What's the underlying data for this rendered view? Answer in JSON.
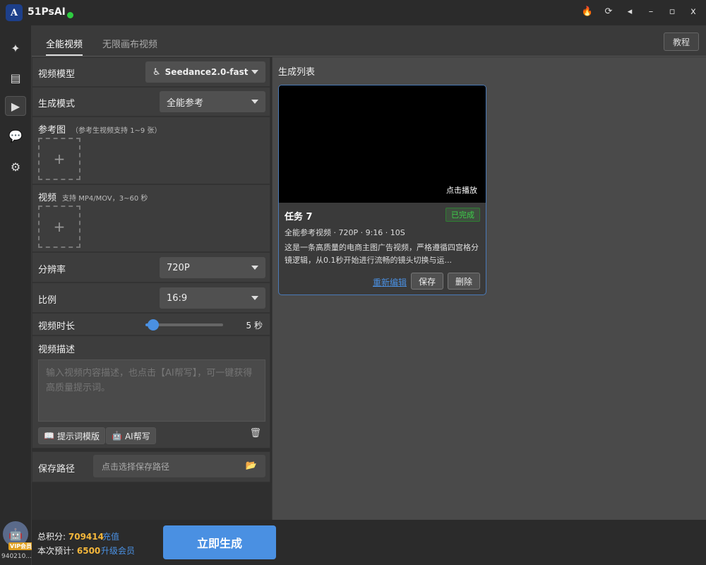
{
  "app": {
    "name": "51PsAI",
    "logo": "A"
  },
  "titlebar_icons": [
    "fire-icon",
    "refresh-icon",
    "pin-icon",
    "minimize-icon",
    "maximize-icon",
    "close-icon"
  ],
  "titlebar": {
    "minimize": "–",
    "maximize": "▫",
    "close": "x"
  },
  "tabs": [
    {
      "label": "全能视频"
    },
    {
      "label": "无限画布视频"
    }
  ],
  "help_label": "教程",
  "form": {
    "model_label": "视频模型",
    "model_value": "Seedance2.0-fast",
    "mode_label": "生成模式",
    "mode_value": "全能参考",
    "ref_label": "参考图",
    "ref_hint": "（参考生视频支持 1~9 张）",
    "video_label": "视频",
    "video_hint": "支持 MP4/MOV，3~60 秒",
    "plus": "+",
    "resolution_label": "分辨率",
    "resolution_value": "720P",
    "ratio_label": "比例",
    "ratio_value": "16:9",
    "duration_label": "视频时长",
    "duration_value": "5 秒",
    "duration_fraction": 0.1,
    "desc_label": "视频描述",
    "desc_placeholder": "输入视频内容描述，也点击【AI帮写】，可一键获得高质量提示词。",
    "template_btn": "提示词模版",
    "ai_btn": "AI帮写",
    "path_label": "保存路径",
    "path_placeholder": "点击选择保存路径"
  },
  "list": {
    "title": "生成列表",
    "card": {
      "play_hint": "点击播放",
      "name": "任务 7",
      "status": "已完成",
      "meta": "全能参考视频 · 720P · 9:16 · 10S",
      "desc": "这是一条高质量的电商主图广告视频，严格遵循四宫格分镜逻辑，从0.1秒开始进行流畅的镜头切换与运...",
      "reedit": "重新编辑",
      "save": "保存",
      "delete": "删除"
    }
  },
  "footer": {
    "total_label": "总积分:",
    "total_value": "709414",
    "recharge": "充值",
    "estimate_label": "本次预计:",
    "estimate_value": "6500",
    "upgrade": "升级会员",
    "generate": "立即生成",
    "vip": "VIP会员",
    "user_id": "940210..."
  },
  "colors": {
    "accent": "#4a90e2",
    "success": "#3ecf4a",
    "points": "#f5b73b"
  }
}
